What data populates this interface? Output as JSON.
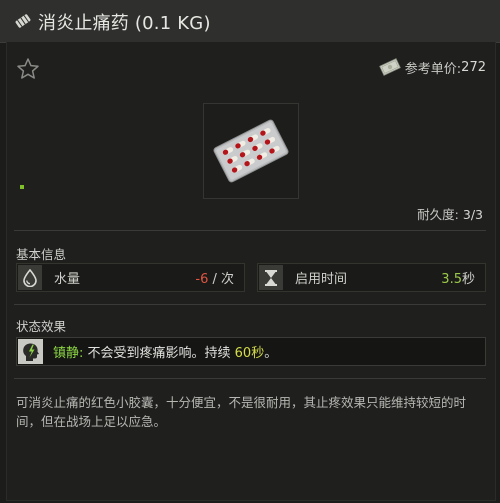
{
  "item": {
    "title": "消炎止痛药 (0.1 KG)",
    "icon": "pill-icon"
  },
  "price": {
    "label": "参考单价:",
    "value": "272",
    "icon": "money-icon"
  },
  "favorite_icon": "star-outline-icon",
  "durability": {
    "label": "耐久度:",
    "value": "3/3"
  },
  "basic_info": {
    "title": "基本信息",
    "stats": [
      {
        "label": "水量",
        "value": "-6",
        "unit": " / 次",
        "icon": "water-drop-icon",
        "value_color": "#e0553f"
      },
      {
        "label": "启用时间",
        "value": "3.5",
        "unit": "秒",
        "icon": "hourglass-icon",
        "value_color": "#9cc94a"
      }
    ]
  },
  "status_effects": {
    "title": "状态效果",
    "effects": [
      {
        "name": "镇静:",
        "text": " 不会受到疼痛影响。持续 ",
        "duration": "60秒",
        "end": "。",
        "icon": "head-painkiller-icon"
      }
    ]
  },
  "description": "可消炎止痛的红色小胶囊，十分便宜，不是很耐用，其止疼效果只能维持较短的时间，但在战场上足以应急。",
  "colors": {
    "background": "#1c1d1b",
    "titlebar": "#2f2f2d",
    "green_accent": "#8bd443",
    "red_value": "#e0553f",
    "yellow_value": "#d6dc4a"
  }
}
